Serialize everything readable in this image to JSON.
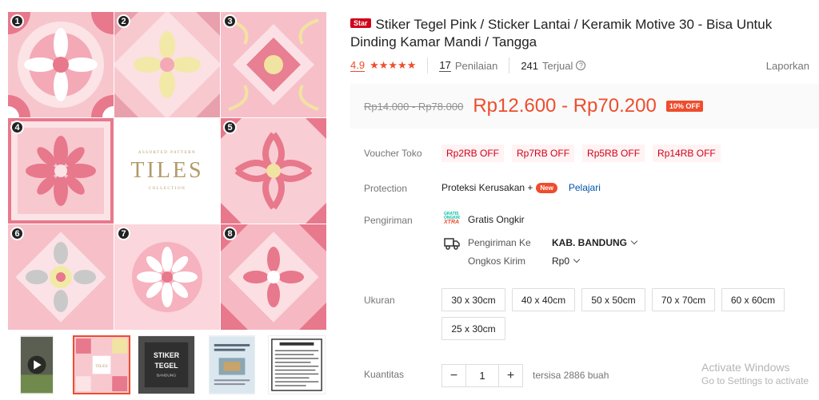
{
  "product": {
    "badge": "Star",
    "title": "Stiker Tegel Pink / Sticker Lantai / Keramik Motive 30 - Bisa Untuk Dinding Kamar Mandi / Tangga",
    "rating": "4.9",
    "stars": "★★★★★",
    "reviews_count": "17",
    "reviews_label": "Penilaian",
    "sold_count": "241",
    "sold_label": "Terjual",
    "report_label": "Laporkan"
  },
  "gallery": {
    "tile_numbers": [
      "1",
      "2",
      "3",
      "4",
      "5",
      "6",
      "7",
      "8"
    ],
    "center_small_top": "ASSORTED PATTERN",
    "center_big": "TILES",
    "center_small_bottom": "COLLECTION",
    "thumb_labels": {
      "t3_line1": "STIKER",
      "t3_line2": "TEGEL",
      "t3_line3": "BANDUNG",
      "t2_mini": "TILES"
    }
  },
  "price": {
    "original": "Rp14.000 - Rp78.000",
    "current": "Rp12.600 - Rp70.200",
    "discount": "10% OFF"
  },
  "vouchers": {
    "label": "Voucher Toko",
    "items": [
      "Rp2RB OFF",
      "Rp7RB OFF",
      "Rp5RB OFF",
      "Rp14RB OFF"
    ]
  },
  "protection": {
    "label": "Protection",
    "text": "Proteksi Kerusakan +",
    "new_badge": "New",
    "learn_more": "Pelajari"
  },
  "shipping": {
    "label": "Pengiriman",
    "free": "Gratis Ongkir",
    "xtra_top": "GRATIS",
    "xtra_mid": "ONGKIR",
    "xtra_logo": "XTRA",
    "to_label": "Pengiriman Ke",
    "to_value": "KAB. BANDUNG",
    "cost_label": "Ongkos Kirim",
    "cost_value": "Rp0"
  },
  "sizes": {
    "label": "Ukuran",
    "options": [
      "30 x 30cm",
      "40 x 40cm",
      "50 x 50cm",
      "70 x 70cm",
      "60 x 60cm",
      "25 x 30cm"
    ]
  },
  "quantity": {
    "label": "Kuantitas",
    "minus": "−",
    "value": "1",
    "plus": "+",
    "stock": "tersisa 2886 buah"
  },
  "watermark": {
    "line1": "Activate Windows",
    "line2": "Go to Settings to activate"
  },
  "colors": {
    "accent": "#ee4d2d",
    "tile_pink": "#f4b6c0",
    "tile_light": "#fbdfe3",
    "tile_deep": "#e8788c",
    "gold": "#b39a6b"
  }
}
